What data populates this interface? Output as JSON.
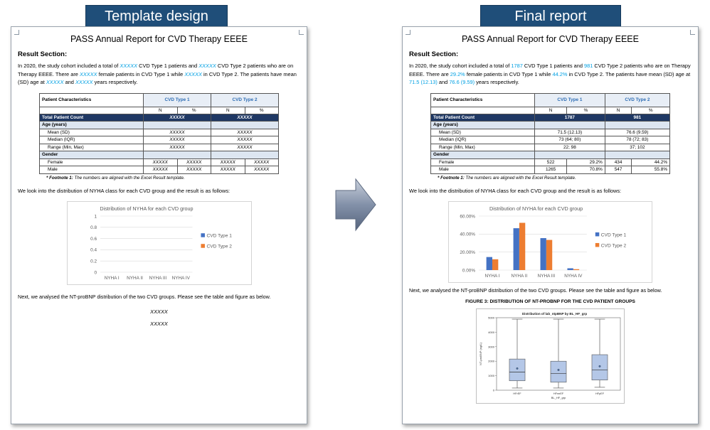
{
  "left": {
    "banner": "Template design",
    "title": "PASS Annual Report for CVD Therapy EEEE",
    "section": "Result Section:",
    "para": [
      {
        "t": "In 2020, the study cohort included a total of "
      },
      {
        "t": "XXXXX",
        "h": true
      },
      {
        "t": " CVD Type 1 patients and "
      },
      {
        "t": "XXXXX",
        "h": true
      },
      {
        "t": " CVD Type 2 patients who are on Therapy EEEE. There are "
      },
      {
        "t": "XXXXX",
        "h": true
      },
      {
        "t": " female patients in CVD Type 1 while "
      },
      {
        "t": "XXXXX",
        "h": true
      },
      {
        "t": " in CVD Type 2. The patients have mean (SD) age at "
      },
      {
        "t": "XXXXX",
        "h": true
      },
      {
        "t": " and "
      },
      {
        "t": "XXXXX",
        "h": true
      },
      {
        "t": " years respectively."
      }
    ],
    "table": {
      "total": [
        "XXXXX",
        "XXXXX"
      ],
      "mean": [
        "XXXXX",
        "XXXXX"
      ],
      "median": [
        "XXXXX",
        "XXXXX"
      ],
      "range": [
        "XXXXX",
        "XXXXX"
      ],
      "female": [
        "XXXXX",
        "XXXXX",
        "XXXXX",
        "XXXXX"
      ],
      "male": [
        "XXXXX",
        "XXXXX",
        "XXXXX",
        "XXXXX"
      ]
    },
    "placeholder_1": "XXXXX",
    "placeholder_2": "XXXXX"
  },
  "right": {
    "banner": "Final report",
    "title": "PASS Annual Report for CVD Therapy EEEE",
    "section": "Result Section:",
    "para": [
      {
        "t": "In 2020, the study cohort included a total of "
      },
      {
        "t": "1787",
        "h": true
      },
      {
        "t": " CVD Type 1 patients and "
      },
      {
        "t": "981",
        "h": true
      },
      {
        "t": " CVD Type 2 patients who are on Therapy EEEE. There are "
      },
      {
        "t": "29.2%",
        "h": true
      },
      {
        "t": " female patients in CVD Type 1 while "
      },
      {
        "t": "44.2%",
        "h": true
      },
      {
        "t": " in CVD Type 2. The patients have mean (SD) age at "
      },
      {
        "t": "71.5 (12.13)",
        "h": true
      },
      {
        "t": " and "
      },
      {
        "t": "76.6 (9.59)",
        "h": true
      },
      {
        "t": " years respectively."
      }
    ],
    "table": {
      "total": [
        "1787",
        "981"
      ],
      "mean": [
        "71.5 (12.13)",
        "76.6 (9.59)"
      ],
      "median": [
        "73 (64; 80)",
        "78 (72; 83)"
      ],
      "range": [
        "22; 98",
        "37; 102"
      ],
      "female": [
        "522",
        "29.2%",
        "434",
        "44.2%"
      ],
      "male": [
        "1265",
        "70.8%",
        "547",
        "55.8%"
      ]
    },
    "figure_title": "FIGURE 3: DISTRIBUTION OF NT-PROBNP FOR THE CVD PATIENT GROUPS"
  },
  "table_labels": {
    "patient_characteristics": "Patient Characteristics",
    "group1": "CVD Type 1",
    "group2": "CVD Type 2",
    "n": "N",
    "pct": "%",
    "total_count": "Total Patient Count",
    "age": "Age (years)",
    "mean": "Mean (SD)",
    "median": "Median (IQR)",
    "range": "Range (Min,  Max)",
    "gender": "Gender",
    "female": "Female",
    "male": "Male"
  },
  "footnote": {
    "label": "* Footnote 1:",
    "text": " The numbers are aligned with the Excel Result template."
  },
  "nyha_intro": "We look into the distribution of NYHA class for each CVD group and the result is as follows:",
  "next_text": "Next, we analysed the NT-proBNP distribution of the two CVD groups. Please see the table and figure as below.",
  "chart_data": [
    {
      "type": "bar",
      "title": "Distribution of NYHA for each CVD group",
      "categories": [
        "NYHA I",
        "NYHA II",
        "NYHA III",
        "NYHA IV"
      ],
      "series": [
        {
          "name": "CVD Type 1",
          "values": [
            0,
            0,
            0,
            0
          ]
        },
        {
          "name": "CVD Type 2",
          "values": [
            0,
            0,
            0,
            0
          ]
        }
      ],
      "ylim": [
        0,
        1
      ],
      "yticks": [
        "0",
        "0.2",
        "0.4",
        "0.6",
        "0.8",
        "1"
      ],
      "legend": "right",
      "colors": [
        "#4472c4",
        "#ed7d31"
      ]
    },
    {
      "type": "bar",
      "title": "Distribution of NYHA for each CVD group",
      "categories": [
        "NYHA I",
        "NYHA II",
        "NYHA III",
        "NYHA IV"
      ],
      "series": [
        {
          "name": "CVD Type 1",
          "values": [
            14.5,
            46.5,
            35.5,
            2.0
          ]
        },
        {
          "name": "CVD Type 2",
          "values": [
            12.0,
            52.5,
            33.5,
            1.0
          ]
        }
      ],
      "ylim": [
        0,
        60
      ],
      "yticks": [
        "0.00%",
        "20.00%",
        "40.00%",
        "60.00%"
      ],
      "legend": "right",
      "colors": [
        "#4472c4",
        "#ed7d31"
      ]
    },
    {
      "type": "box",
      "title": "Distribution of lab_ntpBNP by BL_HF_grp",
      "xlabel": "BL_HF_grp",
      "ylabel": "NT-proBNP (ng/L)",
      "categories": [
        "HFrEF",
        "HFmrEF",
        "HFpEF"
      ],
      "ylim": [
        0,
        5000
      ],
      "yticks": [
        "0",
        "1000",
        "2000",
        "3000",
        "4000",
        "5000"
      ],
      "boxes": [
        {
          "min": 150,
          "q1": 650,
          "median": 1250,
          "q3": 2150,
          "max": 4900,
          "mean": 1500
        },
        {
          "min": 150,
          "q1": 550,
          "median": 1150,
          "q3": 2000,
          "max": 4900,
          "mean": 1400
        },
        {
          "min": 200,
          "q1": 700,
          "median": 1400,
          "q3": 2450,
          "max": 4900,
          "mean": 1650
        }
      ],
      "color": "#b4c7e7"
    }
  ]
}
